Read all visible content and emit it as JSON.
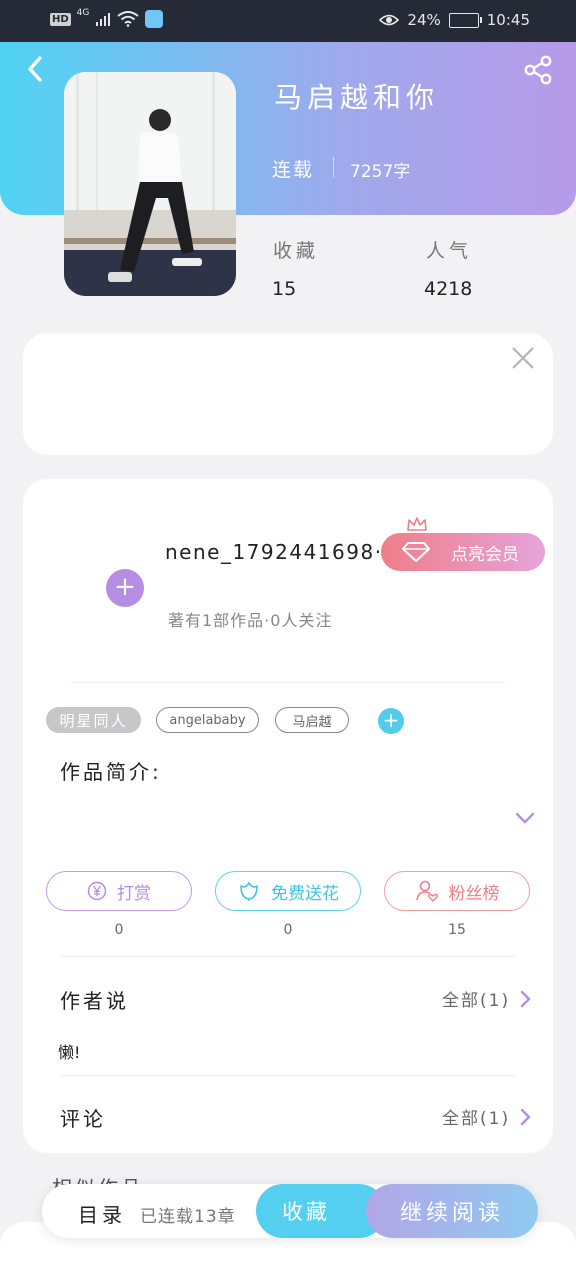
{
  "status_bar": {
    "hd": "HD",
    "network": "4G",
    "battery_percent": "24%",
    "time": "10:45"
  },
  "book": {
    "title": "马启越和你",
    "status": "连载",
    "word_count": "7257字",
    "favorites_label": "收藏",
    "favorites_value": "15",
    "popularity_label": "人气",
    "popularity_value": "4218"
  },
  "author": {
    "username": "nene_1792441698···",
    "meta": "著有1部作品·0人关注",
    "vip_button": "点亮会员"
  },
  "tags": [
    "明星同人",
    "angelababy",
    "马启越"
  ],
  "intro": {
    "heading": "作品简介:"
  },
  "actions": [
    {
      "label": "打赏",
      "count": "0",
      "icon": "yen-icon"
    },
    {
      "label": "免费送花",
      "count": "0",
      "icon": "flower-icon"
    },
    {
      "label": "粉丝榜",
      "count": "15",
      "icon": "user-heart-icon"
    }
  ],
  "author_says": {
    "heading": "作者说",
    "more": "全部(1)",
    "text": "懒!"
  },
  "comments": {
    "heading": "评论",
    "more": "全部(1)"
  },
  "related": {
    "heading": "相似作品"
  },
  "bottom_bar": {
    "toc": "目录",
    "chapters": "已连载13章",
    "collect": "收藏",
    "continue": "继续阅读"
  },
  "colors": {
    "cyan": "#54cff0",
    "purple": "#b58ee3",
    "coral": "#f07e88"
  }
}
